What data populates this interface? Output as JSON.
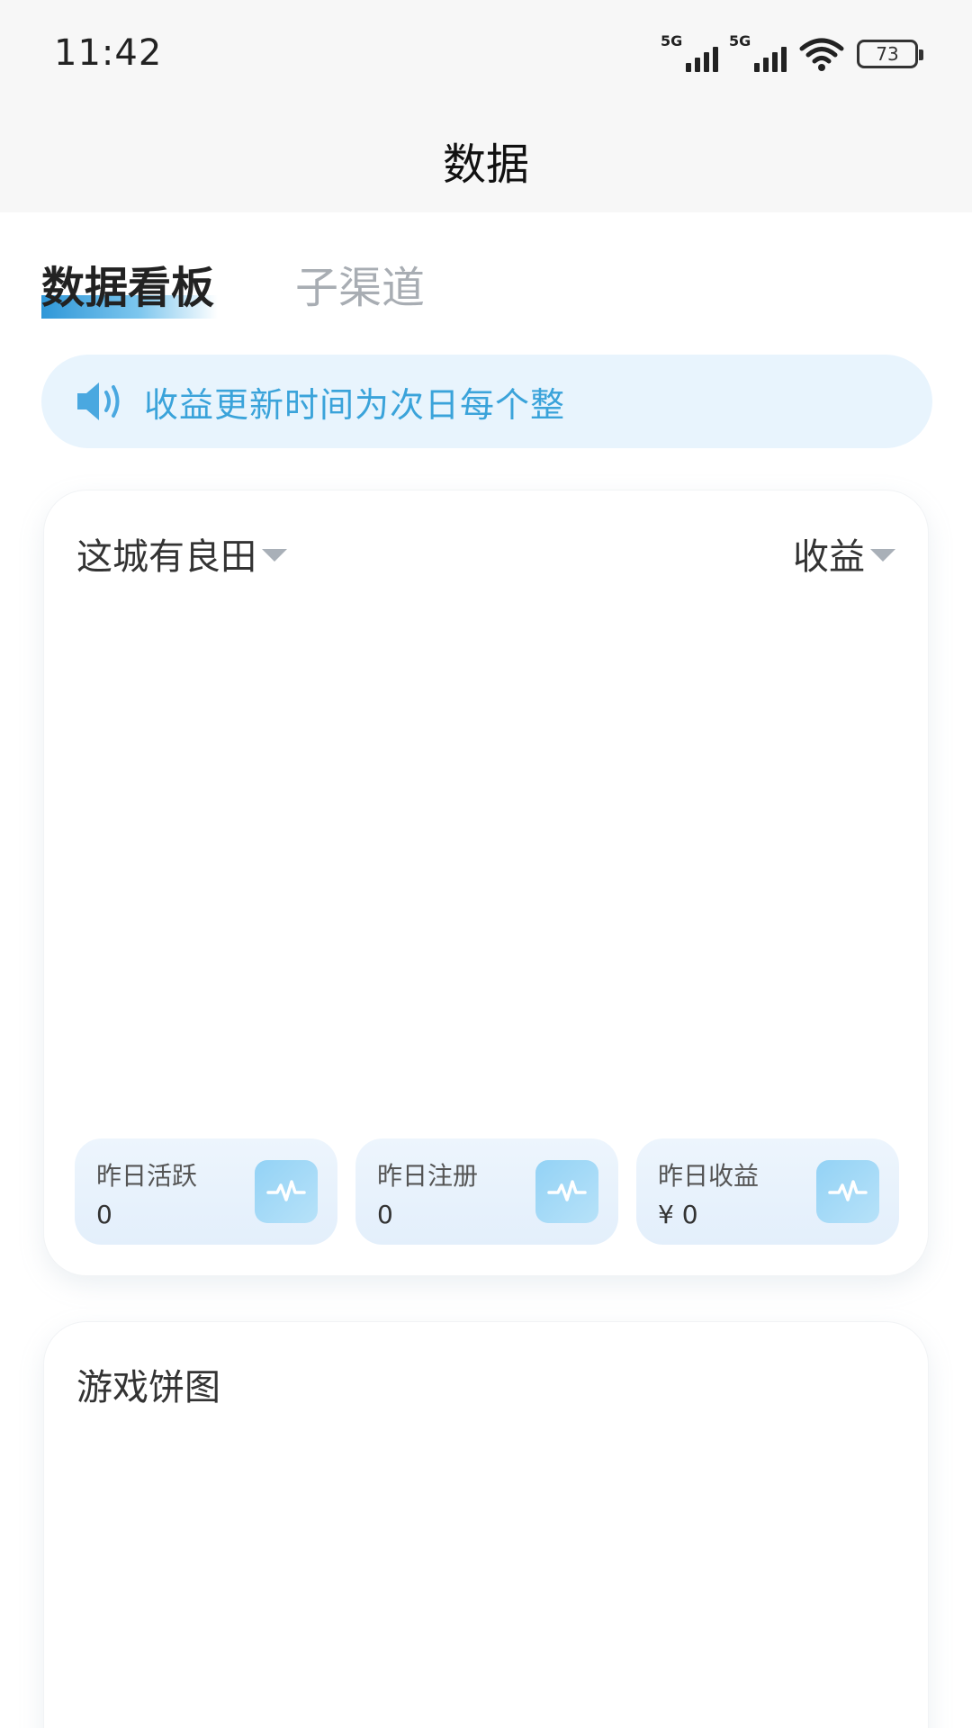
{
  "status_bar": {
    "time": "11:42",
    "sim1_label": "5G",
    "sim2_label": "5G",
    "battery": "73",
    "icons": [
      "signal-icon",
      "signal-icon",
      "wifi-icon",
      "battery-icon"
    ]
  },
  "nav": {
    "title": "数据"
  },
  "tabs": [
    {
      "label": "数据看板",
      "active": true
    },
    {
      "label": "子渠道",
      "active": false
    }
  ],
  "notice": {
    "icon": "speaker-icon",
    "text": "收益更新时间为次日每个整"
  },
  "main_card": {
    "game_select": "这城有良田",
    "metric_select": "收益",
    "stats": [
      {
        "label": "昨日活跃",
        "value": "0",
        "icon": "pulse-icon"
      },
      {
        "label": "昨日注册",
        "value": "0",
        "icon": "pulse-icon"
      },
      {
        "label": "昨日收益",
        "value": "¥ 0",
        "icon": "pulse-icon"
      }
    ]
  },
  "pie_card": {
    "title": "游戏饼图"
  },
  "colors": {
    "accent": "#3aa3da",
    "notice_bg": "#e8f4fd",
    "stat_bg": "#e8f2fc",
    "inactive_tab": "#a8adb3"
  }
}
